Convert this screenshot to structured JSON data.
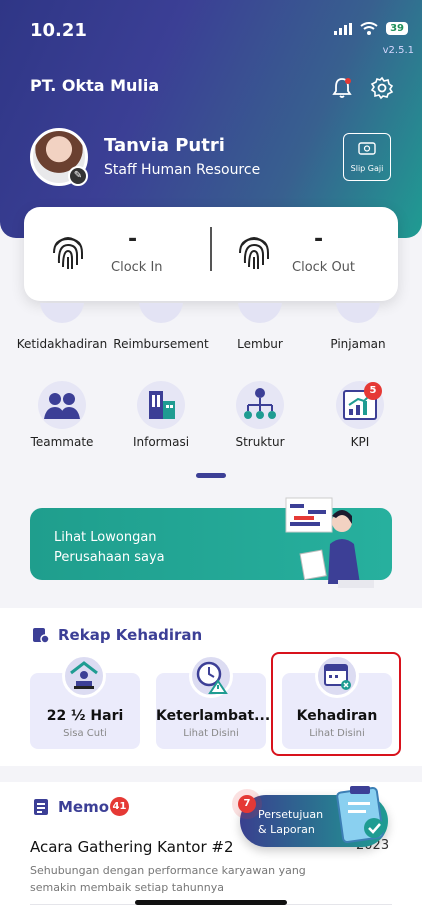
{
  "status_bar": {
    "time": "10.21",
    "battery": "39",
    "version": "v2.5.1"
  },
  "header": {
    "company": "PT. Okta Mulia"
  },
  "profile": {
    "name": "Tanvia Putri",
    "role": "Staff Human Resource",
    "slip_label": "Slip Gaji"
  },
  "clock": {
    "in_value": "-",
    "in_label": "Clock In",
    "out_value": "-",
    "out_label": "Clock Out"
  },
  "menu_row1": [
    "Ketidakhadiran",
    "Reimbursement",
    "Lembur",
    "Pinjaman"
  ],
  "menu_row2": [
    "Teammate",
    "Informasi",
    "Struktur",
    "KPI"
  ],
  "kpi_badge": "5",
  "banner": {
    "line1": "Lihat Lowongan",
    "line2": "Perusahaan saya"
  },
  "rekap": {
    "title": "Rekap Kehadiran",
    "cards": [
      {
        "value": "22 ½ Hari",
        "sub": "Sisa Cuti"
      },
      {
        "value": "Keterlambat...",
        "sub": "Lihat Disini"
      },
      {
        "value": "Kehadiran",
        "sub": "Lihat Disini"
      }
    ]
  },
  "memo": {
    "title": "Memo",
    "badge": "41",
    "item_title": "Acara Gathering Kantor #2",
    "item_date": "2023",
    "item_body": "Sehubungan dengan performance karyawan yang semakin membaik setiap tahunnya"
  },
  "fab": {
    "badge": "7",
    "line1": "Persetujuan",
    "line2": "& Laporan"
  },
  "colors": {
    "primary": "#3c3f96",
    "teal": "#1f9c92",
    "alert": "#e53935",
    "highlight": "#d8121c"
  }
}
